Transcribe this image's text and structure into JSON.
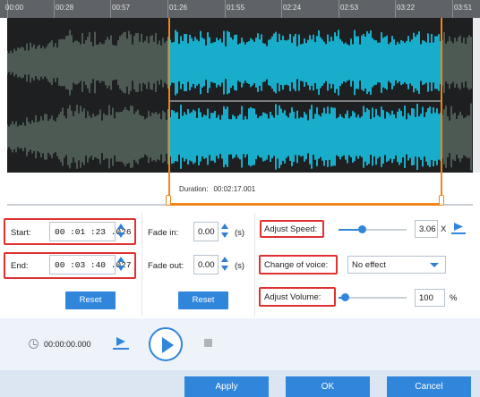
{
  "ruler": {
    "ticks": [
      "00:00",
      "00:28",
      "00:57",
      "01:26",
      "01:55",
      "02:24",
      "02:53",
      "03:22",
      "03:51"
    ]
  },
  "waveform": {
    "selected_color": "#18aecb",
    "unselected_color": "#4d5a54",
    "selection_color": "#f08519"
  },
  "duration": {
    "label": "Duration:",
    "value": "00:02:17.001"
  },
  "trim": {
    "start_label": "Start:",
    "start_value": "00 :01 :23 .026",
    "end_label": "End:",
    "end_value": "00 :03 :40 .027",
    "reset_label": "Reset"
  },
  "fade": {
    "in_label": "Fade in:",
    "in_value": "0.00",
    "out_label": "Fade out:",
    "out_value": "0.00",
    "unit": "(s)",
    "reset_label": "Reset"
  },
  "effects": {
    "speed_label": "Adjust Speed:",
    "speed_value": "3.06",
    "speed_unit": "X",
    "speed_level": 0.35,
    "voice_label": "Change of voice:",
    "voice_value": "No effect",
    "volume_label": "Adjust Volume:",
    "volume_value": "100",
    "volume_unit": "%",
    "volume_level": 0.1
  },
  "player": {
    "time": "00:00:00.000"
  },
  "buttons": {
    "apply": "Apply",
    "ok": "OK",
    "cancel": "Cancel"
  },
  "colors": {
    "accent": "#2f86db",
    "highlight": "#e03131"
  }
}
